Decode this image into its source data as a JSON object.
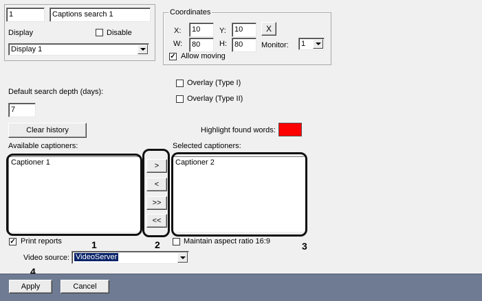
{
  "top": {
    "id_value": "1",
    "name_value": "Captions search 1",
    "display_label": "Display",
    "disable_label": "Disable",
    "display_select": "Display 1"
  },
  "coordinates": {
    "title": "Coordinates",
    "x_label": "X:",
    "x_value": "10",
    "y_label": "Y:",
    "y_value": "10",
    "close_glyph": "X",
    "w_label": "W:",
    "w_value": "80",
    "h_label": "H:",
    "h_value": "80",
    "monitor_label": "Monitor:",
    "monitor_value": "1",
    "allow_moving_label": "Allow moving",
    "allow_moving_checked": true
  },
  "settings": {
    "depth_label": "Default search depth (days):",
    "depth_value": "7",
    "overlay1_label": "Overlay (Type I)",
    "overlay2_label": "Overlay (Type II)",
    "clear_history_label": "Clear history",
    "highlight_label": "Highlight found words:",
    "highlight_color": "#ff0000"
  },
  "captioners": {
    "available_label": "Available captioners:",
    "available_items": [
      "Captioner 1"
    ],
    "selected_label": "Selected captioners:",
    "selected_items": [
      "Captioner 2"
    ],
    "move_right": ">",
    "move_left": "<",
    "move_all_right": ">>",
    "move_all_left": "<<"
  },
  "bottom": {
    "print_reports_label": "Print reports",
    "print_reports_checked": true,
    "aspect_label": "Maintain aspect ratio 16:9",
    "video_source_label": "Video source:",
    "video_source_value": "VideoServer"
  },
  "footer": {
    "apply_label": "Apply",
    "cancel_label": "Cancel"
  },
  "annotations": {
    "n1": "1",
    "n2": "2",
    "n3": "3",
    "n4": "4"
  }
}
